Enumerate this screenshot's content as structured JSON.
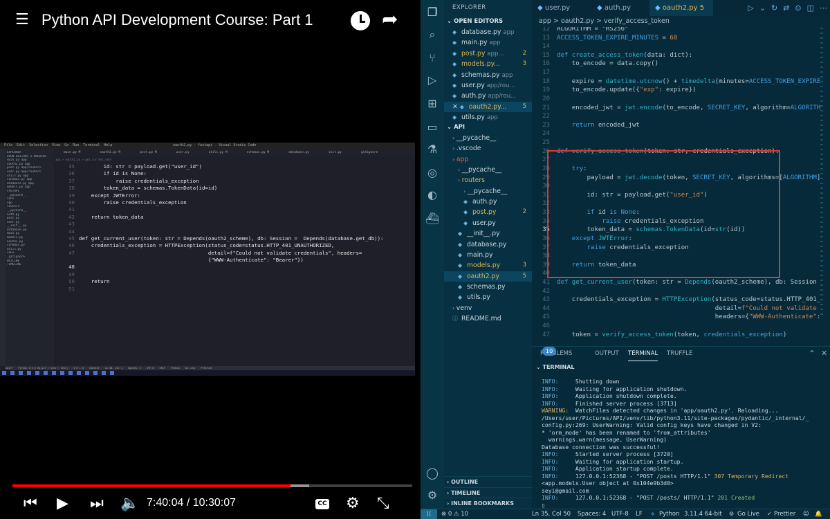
{
  "player": {
    "title": "Python API Development Course: Part 1",
    "time_current": "7:40:04",
    "time_total": "10:30:07",
    "played_fraction": 0.696,
    "buffered_fraction": 0.742,
    "cc_label": "CC",
    "icons": [
      "menu-icon",
      "watch-later-icon",
      "share-icon",
      "previous-icon",
      "play-icon",
      "next-icon",
      "volume-icon",
      "captions-icon",
      "settings-icon",
      "fullscreen-icon"
    ]
  },
  "embedded": {
    "menu": [
      "File",
      "Edit",
      "Selection",
      "View",
      "Go",
      "Run",
      "Terminal",
      "Help"
    ],
    "window_title": "oauth2.py - fastapi - Visual Studio Code",
    "tabs": [
      "main.py M",
      "oauth2.py M",
      "post.py M",
      "user.py",
      "utils.py M",
      "schemas.py M",
      "database.py",
      "init.py",
      "gitignore"
    ],
    "breadcrumb": "app > oauth2.py > get_current_user",
    "sidebar": [
      "EXPLORER",
      "OPEN EDITORS 1 UNSAVED",
      "main.py app",
      "oauth2.py app",
      "post.py app/routers",
      "user.py app/routers",
      "utils.py app",
      "schemas.py app",
      "database.py app",
      "models.py app",
      "FASTAPI",
      "__pycache__",
      "venv",
      "app",
      "routers",
      "__pycache__",
      "auth.py",
      "post.py",
      "user.py",
      "__init__.py",
      "database.py",
      "main.py",
      "models.py",
      "oauth2.py",
      "schemas.py",
      "utils.py",
      "venv",
      ".gitignore",
      "OUTLINE",
      "TIMELINE"
    ],
    "code": [
      {
        "n": "35",
        "t": "        id: str = payload.get(\"user_id\")"
      },
      {
        "n": "36",
        "t": "        if id is None:"
      },
      {
        "n": "37",
        "t": "            raise credentials_exception"
      },
      {
        "n": "38",
        "t": "        token_data = schemas.TokenData(id=id)"
      },
      {
        "n": "39",
        "t": "    except JWTError:"
      },
      {
        "n": "40",
        "t": "        raise credentials_exception"
      },
      {
        "n": "41",
        "t": ""
      },
      {
        "n": "42",
        "t": "    return token_data"
      },
      {
        "n": "43",
        "t": ""
      },
      {
        "n": "44",
        "t": ""
      },
      {
        "n": "45",
        "t": "def get_current_user(token: str = Depends(oauth2_scheme), db: Session =  Depends(database.get_db)):"
      },
      {
        "n": "46",
        "t": "    credentials_exception = HTTPException(status_code=status.HTTP_401_UNAUTHORIZED,"
      },
      {
        "n": "47",
        "t": "                                          detail=f\"Could not validate credentials\", headers="
      },
      {
        "n": "",
        "t": "                                          {\"WWW-Authenticate\": \"Bearer\"})"
      },
      {
        "n": "48",
        "t": ""
      },
      {
        "n": "49",
        "t": ""
      },
      {
        "n": "50",
        "t": "    return"
      },
      {
        "n": "51",
        "t": ""
      }
    ],
    "status": [
      "main*",
      "Python 3.9.5 64-bit ('venv': venv)",
      "⊗ 0 ⚠ 0",
      "Connect",
      "Ln 48, Col 1",
      "Spaces: 4",
      "UTF-8",
      "CRLF",
      "Python",
      "Go Live",
      "Prettier"
    ]
  },
  "vscode": {
    "explorer_title": "EXPLORER",
    "open_editors_label": "OPEN EDITORS",
    "open_editors": [
      {
        "name": "database.py",
        "hint": "app",
        "badge": "",
        "cls": ""
      },
      {
        "name": "main.py",
        "hint": "app",
        "badge": "",
        "cls": ""
      },
      {
        "name": "post.py",
        "hint": "app...",
        "badge": "2",
        "cls": "mod"
      },
      {
        "name": "models.py...",
        "hint": "",
        "badge": "3",
        "cls": "mod"
      },
      {
        "name": "schemas.py",
        "hint": "app",
        "badge": "",
        "cls": ""
      },
      {
        "name": "user.py",
        "hint": "app/rou...",
        "badge": "",
        "cls": ""
      },
      {
        "name": "auth.py",
        "hint": "app/rou...",
        "badge": "",
        "cls": ""
      },
      {
        "name": "oauth2.py...",
        "hint": "",
        "badge": "5",
        "cls": "mod"
      },
      {
        "name": "utils.py",
        "hint": "app",
        "badge": "",
        "cls": ""
      }
    ],
    "project_label": "API",
    "tree": [
      {
        "name": "__pycache__",
        "badge": "",
        "cls": "",
        "indent": 0,
        "dir": true
      },
      {
        "name": ".vscode",
        "badge": "",
        "cls": "",
        "indent": 0,
        "dir": true
      },
      {
        "name": "app",
        "badge": "",
        "cls": "err",
        "indent": 0,
        "dir": true
      },
      {
        "name": "__pycache__",
        "badge": "",
        "cls": "",
        "indent": 1,
        "dir": true
      },
      {
        "name": "routers",
        "badge": "",
        "cls": "mod",
        "indent": 1,
        "dir": true
      },
      {
        "name": "__pycache__",
        "badge": "",
        "cls": "",
        "indent": 2,
        "dir": true
      },
      {
        "name": "auth.py",
        "badge": "",
        "cls": "",
        "indent": 2,
        "dir": false
      },
      {
        "name": "post.py",
        "badge": "2",
        "cls": "mod",
        "indent": 2,
        "dir": false
      },
      {
        "name": "user.py",
        "badge": "",
        "cls": "",
        "indent": 2,
        "dir": false
      },
      {
        "name": "__init__.py",
        "badge": "",
        "cls": "",
        "indent": 1,
        "dir": false
      },
      {
        "name": "database.py",
        "badge": "",
        "cls": "",
        "indent": 1,
        "dir": false
      },
      {
        "name": "main.py",
        "badge": "",
        "cls": "",
        "indent": 1,
        "dir": false
      },
      {
        "name": "models.py",
        "badge": "3",
        "cls": "mod",
        "indent": 1,
        "dir": false
      },
      {
        "name": "oauth2.py",
        "badge": "5",
        "cls": "mod",
        "indent": 1,
        "dir": false
      },
      {
        "name": "schemas.py",
        "badge": "",
        "cls": "",
        "indent": 1,
        "dir": false
      },
      {
        "name": "utils.py",
        "badge": "",
        "cls": "",
        "indent": 1,
        "dir": false
      },
      {
        "name": "venv",
        "badge": "",
        "cls": "",
        "indent": 0,
        "dir": true
      },
      {
        "name": "README.md",
        "badge": "",
        "cls": "",
        "indent": 0,
        "dir": false
      }
    ],
    "outline_label": "OUTLINE",
    "timeline_label": "TIMELINE",
    "bookmarks_label": "INLINE BOOKMARKS",
    "tabs": [
      "user.py",
      "auth.py",
      "oauth2.py 5"
    ],
    "breadcrumb": "app > oauth2.py > verify_access_token",
    "code": [
      {
        "n": "12",
        "h": "<span class='c2'>ALGORITHM = \"HS256\"</span>"
      },
      {
        "n": "13",
        "h": "<span class='v'>ACCESS_TOKEN_EXPIRE_MINUTES</span> = <span class='s'>60</span>"
      },
      {
        "n": "14",
        "h": ""
      },
      {
        "n": "15",
        "h": "<span class='k'>def</span> <span class='f'>create_access_token</span>(data: dict):"
      },
      {
        "n": "16",
        "h": "    to_encode = data.copy()"
      },
      {
        "n": "17",
        "h": ""
      },
      {
        "n": "18",
        "h": "    expire = <span class='f'>datetime.utcnow</span>() + <span class='f'>timedelta</span>(minutes=<span class='v'>ACCESS_TOKEN_EXPIRE</span>"
      },
      {
        "n": "19",
        "h": "    to_encode.update({<span class='s'>\"exp\"</span>: expire})"
      },
      {
        "n": "20",
        "h": ""
      },
      {
        "n": "21",
        "h": "    encoded_jwt = <span class='f'>jwt.encode</span>(to_encode, <span class='v'>SECRET_KEY</span>, algorithm=<span class='v'>ALGORITH</span>"
      },
      {
        "n": "22",
        "h": ""
      },
      {
        "n": "23",
        "h": "    <span class='k'>return</span> encoded_jwt"
      },
      {
        "n": "24",
        "h": ""
      },
      {
        "n": "25",
        "h": ""
      },
      {
        "n": "26",
        "h": "<span class='k'>def</span> <span class='f'>verify_access_token</span>(token: str, credentials_exception):"
      },
      {
        "n": "27",
        "h": ""
      },
      {
        "n": "28",
        "h": "    <span class='k'>try</span>:"
      },
      {
        "n": "29",
        "h": "        payload = <span class='f'>jwt.decode</span>(token, <span class='v'>SECRET_KEY</span>, algorithms=[<span class='v'>ALGORITHM</span>]"
      },
      {
        "n": "30",
        "h": ""
      },
      {
        "n": "31",
        "h": "        id: str = payload.get(<span class='s'>\"user_id\"</span>)"
      },
      {
        "n": "32",
        "h": ""
      },
      {
        "n": "33",
        "h": "        <span class='k'>if</span> id <span class='k'>is</span> <span class='k'>None</span>:"
      },
      {
        "n": "34",
        "h": "            <span class='k'>raise</span> credentials_exception"
      },
      {
        "n": "35",
        "h": "        token_data = <span class='f'>schemas.TokenData</span>(id=<span class='f'>str</span>(id))"
      },
      {
        "n": "36",
        "h": "    <span class='k'>except</span> <span class='f'>JWTError</span>:"
      },
      {
        "n": "37",
        "h": "        <span class='k'>raise</span> credentials_exception"
      },
      {
        "n": "38",
        "h": ""
      },
      {
        "n": "39",
        "h": "    <span class='k'>return</span> token_data"
      },
      {
        "n": "40",
        "h": ""
      },
      {
        "n": "41",
        "h": "<span class='k'>def</span> <span class='f'>get_current_user</span>(token: str = <span class='f'>Depends</span>(oauth2_scheme), db: Session"
      },
      {
        "n": "42",
        "h": ""
      },
      {
        "n": "43",
        "h": "    credentials_exception = <span class='f'>HTTPException</span>(status_code=status.HTTP_401_"
      },
      {
        "n": "44",
        "h": "                                          detail=<span class='s'>f\"Could not validate</span>"
      },
      {
        "n": "45",
        "h": "                                          headers={<span class='s'>\"WWW-Authenticate\"</span>:"
      },
      {
        "n": "46",
        "h": ""
      },
      {
        "n": "47",
        "h": "    token = <span class='f'>verify_access_token</span>(token, <span class='v'>credentials_exception</span>)"
      }
    ],
    "panel_tabs": [
      "PROBLEMS",
      "OUTPUT",
      "TERMINAL",
      "TRUFFLE"
    ],
    "problems_count": "10",
    "terminal_label": "TERMINAL",
    "terminal": [
      {
        "lv": "INFO:",
        "msg": "     Shutting down",
        "extra": "",
        "cls": "lv"
      },
      {
        "lv": "INFO:",
        "msg": "     Waiting for application shutdown.",
        "extra": "",
        "cls": "lv"
      },
      {
        "lv": "INFO:",
        "msg": "     Application shutdown complete.",
        "extra": "",
        "cls": "lv"
      },
      {
        "lv": "INFO:",
        "msg": "     Finished server process [3713]",
        "extra": "",
        "cls": "lv"
      },
      {
        "lv": "WARNING:",
        "msg": "  WatchFiles detected changes in 'app/oauth2.py'. Reloading...",
        "extra": "",
        "cls": "warn"
      },
      {
        "lv": "",
        "msg": "/Users/user/Pictures/API/venv/lib/python3.11/site-packages/pydantic/_internal/_",
        "extra": "",
        "cls": "lv"
      },
      {
        "lv": "",
        "msg": "config.py:269: UserWarning: Valid config keys have changed in V2:",
        "extra": "",
        "cls": "lv"
      },
      {
        "lv": "",
        "msg": "* 'orm_mode' has been renamed to 'from_attributes'",
        "extra": "",
        "cls": "lv"
      },
      {
        "lv": "",
        "msg": "  warnings.warn(message, UserWarning)",
        "extra": "",
        "cls": "lv"
      },
      {
        "lv": "",
        "msg": "Database connection was successful!",
        "extra": "",
        "cls": "lv"
      },
      {
        "lv": "INFO:",
        "msg": "     Started server process [3720]",
        "extra": "",
        "cls": "lv"
      },
      {
        "lv": "INFO:",
        "msg": "     Waiting for application startup.",
        "extra": "",
        "cls": "lv"
      },
      {
        "lv": "INFO:",
        "msg": "     Application startup complete.",
        "extra": "",
        "cls": "lv"
      },
      {
        "lv": "INFO:",
        "msg": "     127.0.0.1:52368 - \"POST /posts HTTP/1.1\" ",
        "extra": "307 Temporary Redirect",
        "cls": "rcode"
      },
      {
        "lv": "",
        "msg": "<app.models.User object at 0x104e9b3d0>",
        "extra": "",
        "cls": "lv"
      },
      {
        "lv": "",
        "msg": "seyi@gmail.com",
        "extra": "",
        "cls": "lv"
      },
      {
        "lv": "INFO:",
        "msg": "     127.0.0.1:52368 - \"POST /posts/ HTTP/1.1\" ",
        "extra": "201 Created",
        "cls": "code"
      },
      {
        "lv": "",
        "msg": "▯",
        "extra": "",
        "cls": "lv"
      }
    ],
    "status": {
      "problems": "⊗ 0 ⚠ 10",
      "position": "Ln 35, Col 50",
      "spaces": "Spaces: 4",
      "encoding": "UTF-8",
      "eol": "LF",
      "language": "Python",
      "interpreter": "3.11.4 64-bit",
      "golive": "Go Live",
      "prettier": "Prettier"
    },
    "colors": {
      "highlight_box": "#d83a31",
      "modified": "#d9b45a",
      "background": "#072a3a"
    }
  }
}
